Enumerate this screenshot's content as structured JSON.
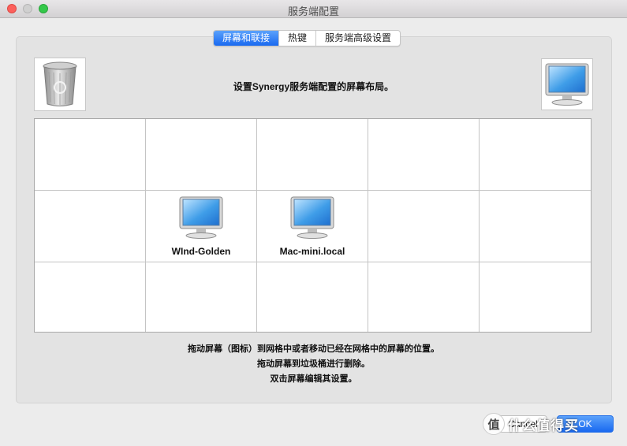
{
  "window": {
    "title": "服务端配置"
  },
  "tabs": [
    {
      "label": "屏幕和联接",
      "active": true
    },
    {
      "label": "热键",
      "active": false
    },
    {
      "label": "服务端高级设置",
      "active": false
    }
  ],
  "top_instruction": "设置Synergy服务端配置的屏幕布局。",
  "trash": {
    "icon": "trash-can-icon"
  },
  "new_screen": {
    "icon": "monitor-icon"
  },
  "grid": {
    "columns": 5,
    "rows": 3,
    "screens": [
      {
        "row": 2,
        "col": 2,
        "name": "WInd-Golden",
        "icon": "monitor-icon"
      },
      {
        "row": 2,
        "col": 3,
        "name": "Mac-mini.local",
        "icon": "monitor-icon"
      }
    ]
  },
  "notes": [
    "拖动屏幕（图标）到网格中或者移动已经在网格中的屏幕的位置。",
    "拖动屏幕到垃圾桶进行删除。",
    "双击屏幕编辑其设置。"
  ],
  "buttons": {
    "cancel": "Cancel",
    "ok": "OK"
  },
  "watermark": {
    "badge": "值",
    "text": "什么值得买"
  },
  "colors": {
    "accent": "#1969f0",
    "close": "#fc605c",
    "maximize": "#34c84a"
  }
}
